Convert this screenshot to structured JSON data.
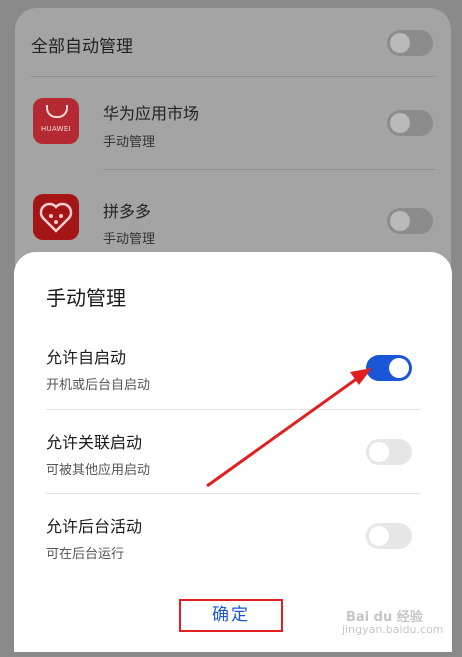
{
  "background_list": {
    "auto_manage_all_label": "全部自动管理",
    "apps": [
      {
        "name": "华为应用市场",
        "status": "手动管理",
        "icon_text": "HUAWEI"
      },
      {
        "name": "拼多多",
        "status": "手动管理"
      }
    ]
  },
  "dialog": {
    "title": "手动管理",
    "options": [
      {
        "label": "允许自启动",
        "description": "开机或后台自启动",
        "enabled": true
      },
      {
        "label": "允许关联启动",
        "description": "可被其他应用启动",
        "enabled": false
      },
      {
        "label": "允许后台活动",
        "description": "可在后台运行",
        "enabled": false
      }
    ],
    "confirm_label": "确定"
  },
  "watermark": {
    "line1": "Bai du 经验",
    "line2": "jingyan.baidu.com"
  },
  "colors": {
    "accent": "#1a57d6",
    "annotation": "#e02020"
  }
}
